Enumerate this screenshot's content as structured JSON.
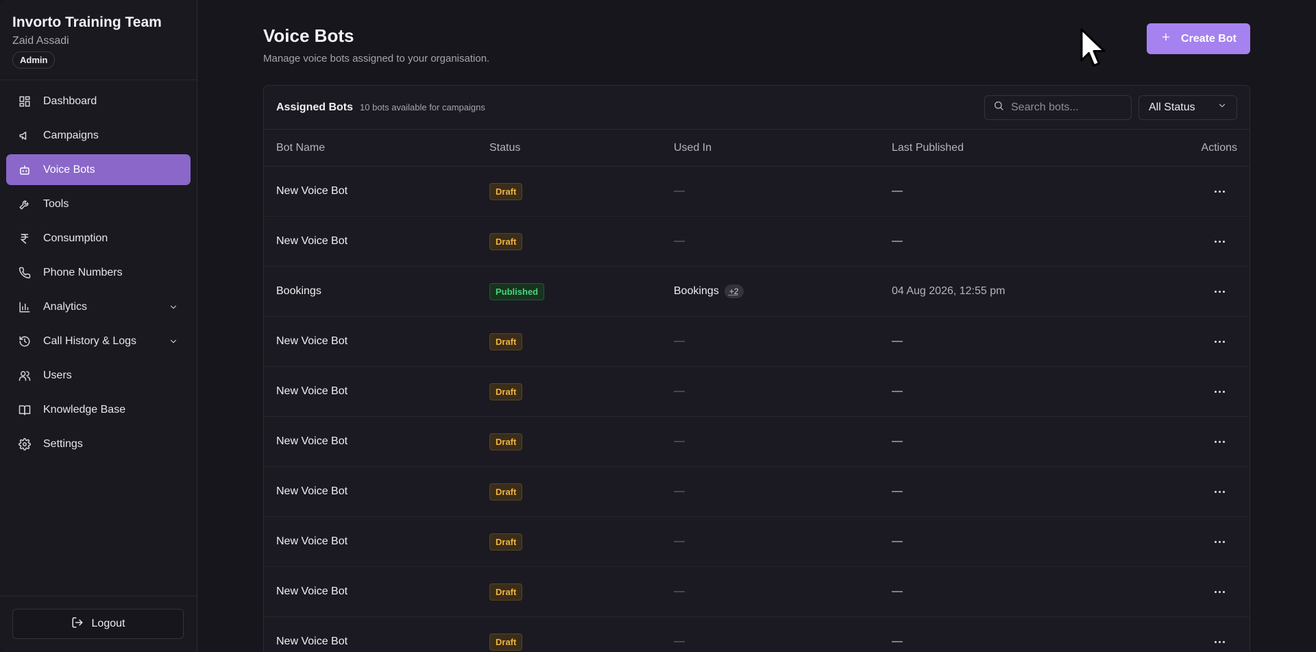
{
  "org": {
    "name": "Invorto Training Team",
    "user": "Zaid Assadi",
    "role": "Admin"
  },
  "nav": [
    {
      "label": "Dashboard",
      "icon": "dashboard-icon",
      "active": false,
      "expandable": false
    },
    {
      "label": "Campaigns",
      "icon": "megaphone-icon",
      "active": false,
      "expandable": false
    },
    {
      "label": "Voice Bots",
      "icon": "bot-icon",
      "active": true,
      "expandable": false
    },
    {
      "label": "Tools",
      "icon": "wrench-icon",
      "active": false,
      "expandable": false
    },
    {
      "label": "Consumption",
      "icon": "rupee-icon",
      "active": false,
      "expandable": false
    },
    {
      "label": "Phone Numbers",
      "icon": "phone-icon",
      "active": false,
      "expandable": false
    },
    {
      "label": "Analytics",
      "icon": "bar-chart-icon",
      "active": false,
      "expandable": true
    },
    {
      "label": "Call History & Logs",
      "icon": "history-icon",
      "active": false,
      "expandable": true
    },
    {
      "label": "Users",
      "icon": "users-icon",
      "active": false,
      "expandable": false
    },
    {
      "label": "Knowledge Base",
      "icon": "book-icon",
      "active": false,
      "expandable": false
    },
    {
      "label": "Settings",
      "icon": "gear-icon",
      "active": false,
      "expandable": false
    }
  ],
  "logout": {
    "label": "Logout"
  },
  "header": {
    "title": "Voice Bots",
    "subtitle": "Manage voice bots assigned to your organisation.",
    "create_label": "Create Bot"
  },
  "panel": {
    "title": "Assigned Bots",
    "count_text": "10 bots available for campaigns",
    "search_placeholder": "Search bots...",
    "status_filter": "All Status"
  },
  "table": {
    "columns": [
      "Bot Name",
      "Status",
      "Used In",
      "Last Published",
      "Actions"
    ],
    "rows": [
      {
        "name": "New Voice Bot",
        "status": "Draft",
        "used_in": "—",
        "used_more": "",
        "last_published": "—"
      },
      {
        "name": "New Voice Bot",
        "status": "Draft",
        "used_in": "—",
        "used_more": "",
        "last_published": "—"
      },
      {
        "name": "Bookings",
        "status": "Published",
        "used_in": "Bookings",
        "used_more": "+2",
        "last_published": "04 Aug 2026, 12:55 pm"
      },
      {
        "name": "New Voice Bot",
        "status": "Draft",
        "used_in": "—",
        "used_more": "",
        "last_published": "—"
      },
      {
        "name": "New Voice Bot",
        "status": "Draft",
        "used_in": "—",
        "used_more": "",
        "last_published": "—"
      },
      {
        "name": "New Voice Bot",
        "status": "Draft",
        "used_in": "—",
        "used_more": "",
        "last_published": "—"
      },
      {
        "name": "New Voice Bot",
        "status": "Draft",
        "used_in": "—",
        "used_more": "",
        "last_published": "—"
      },
      {
        "name": "New Voice Bot",
        "status": "Draft",
        "used_in": "—",
        "used_more": "",
        "last_published": "—"
      },
      {
        "name": "New Voice Bot",
        "status": "Draft",
        "used_in": "—",
        "used_more": "",
        "last_published": "—"
      },
      {
        "name": "New Voice Bot",
        "status": "Draft",
        "used_in": "—",
        "used_more": "",
        "last_published": "—"
      }
    ]
  },
  "colors": {
    "accent": "#8a67c9",
    "button": "#a582f0",
    "draft": "#f2b33d",
    "published": "#47d47c"
  }
}
